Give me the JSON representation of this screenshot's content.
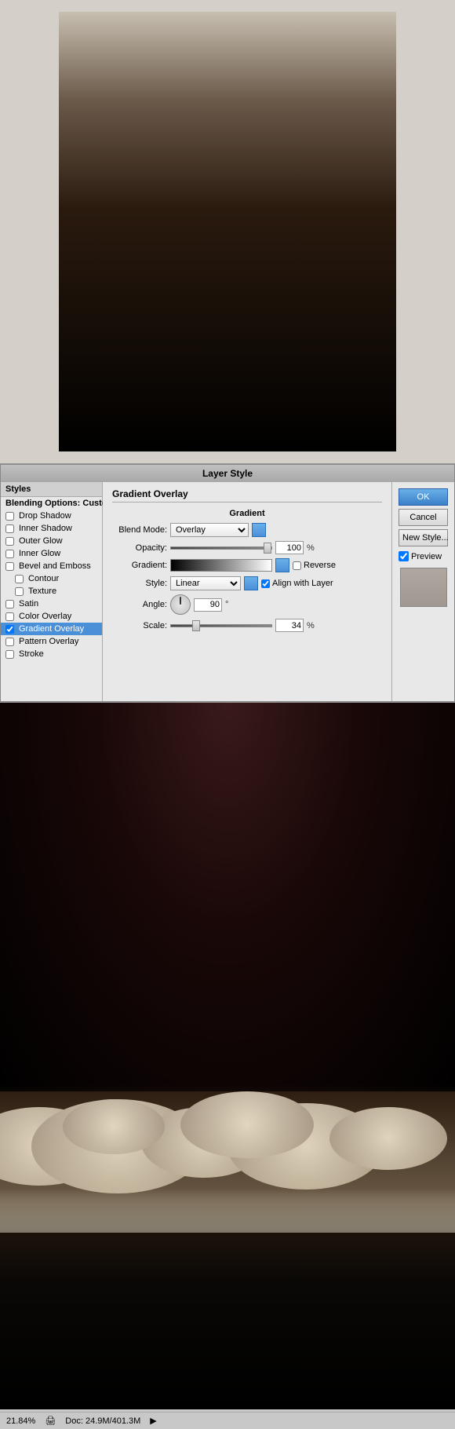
{
  "dialog": {
    "title": "Layer Style",
    "styles_header": "Styles",
    "blending_options": "Blending Options: Custom",
    "style_items": [
      {
        "id": "drop-shadow",
        "label": "Drop Shadow",
        "checked": false
      },
      {
        "id": "inner-shadow",
        "label": "Inner Shadow",
        "checked": false
      },
      {
        "id": "outer-glow",
        "label": "Outer Glow",
        "checked": false
      },
      {
        "id": "inner-glow",
        "label": "Inner Glow",
        "checked": false
      },
      {
        "id": "bevel-emboss",
        "label": "Bevel and Emboss",
        "checked": false
      },
      {
        "id": "contour",
        "label": "Contour",
        "checked": false
      },
      {
        "id": "texture",
        "label": "Texture",
        "checked": false
      },
      {
        "id": "satin",
        "label": "Satin",
        "checked": false
      },
      {
        "id": "color-overlay",
        "label": "Color Overlay",
        "checked": false
      },
      {
        "id": "gradient-overlay",
        "label": "Gradient Overlay",
        "checked": true,
        "active": true
      },
      {
        "id": "pattern-overlay",
        "label": "Pattern Overlay",
        "checked": false
      },
      {
        "id": "stroke",
        "label": "Stroke",
        "checked": false
      }
    ],
    "section_title": "Gradient Overlay",
    "subsection_title": "Gradient",
    "fields": {
      "blend_mode_label": "Blend Mode:",
      "blend_mode_value": "Overlay",
      "opacity_label": "Opacity:",
      "opacity_value": "100",
      "opacity_unit": "%",
      "gradient_label": "Gradient:",
      "reverse_label": "Reverse",
      "style_label": "Style:",
      "style_value": "Linear",
      "align_layer_label": "Align with Layer",
      "angle_label": "Angle:",
      "angle_value": "90",
      "angle_unit": "°",
      "scale_label": "Scale:",
      "scale_value": "34",
      "scale_unit": "%"
    },
    "buttons": {
      "ok": "OK",
      "cancel": "Cancel",
      "new_style": "New Style...",
      "preview_label": "Preview",
      "preview_checked": true
    }
  },
  "status_bar": {
    "zoom": "21.84%",
    "doc_info": "Doc: 24.9M/401.3M"
  }
}
